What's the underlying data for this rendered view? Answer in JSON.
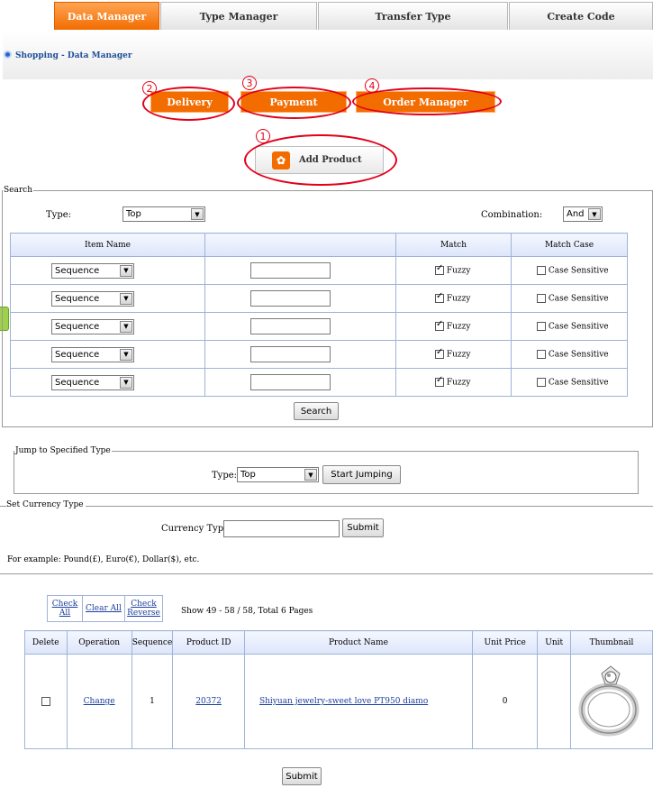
{
  "tabs": [
    {
      "label": "Data Manager",
      "active": true
    },
    {
      "label": "Type Manager"
    },
    {
      "label": "Transfer Type"
    },
    {
      "label": "Create Code"
    }
  ],
  "breadcrumb": "Shopping - Data Manager",
  "actions": {
    "delivery": "Delivery",
    "payment": "Payment",
    "order_manager": "Order Manager",
    "add_product": "Add Product",
    "markers": [
      "1",
      "2",
      "3",
      "4"
    ]
  },
  "search": {
    "legend": "Search",
    "type_label": "Type:",
    "type_value": "Top",
    "combination_label": "Combination:",
    "combination_value": "And",
    "headers": [
      "Item Name",
      "",
      "Match",
      "Match Case"
    ],
    "rows": [
      {
        "item": "Sequence",
        "value": "",
        "fuzzy": "Fuzzy",
        "case": "Case Sensitive"
      },
      {
        "item": "Sequence",
        "value": "",
        "fuzzy": "Fuzzy",
        "case": "Case Sensitive"
      },
      {
        "item": "Sequence",
        "value": "",
        "fuzzy": "Fuzzy",
        "case": "Case Sensitive"
      },
      {
        "item": "Sequence",
        "value": "",
        "fuzzy": "Fuzzy",
        "case": "Case Sensitive"
      },
      {
        "item": "Sequence",
        "value": "",
        "fuzzy": "Fuzzy",
        "case": "Case Sensitive"
      }
    ],
    "button": "Search"
  },
  "jump": {
    "legend": "Jump to Specified Type",
    "type_label": "Type:",
    "type_value": "Top",
    "button": "Start Jumping"
  },
  "currency": {
    "legend": "Set Currency Type",
    "label": "Currency Type:",
    "value": "",
    "button": "Submit",
    "example": "For example: Pound(£), Euro(€), Dollar($), etc."
  },
  "list": {
    "check_all": "Check All",
    "clear_all": "Clear All",
    "check_reverse": "Check Reverse",
    "paging": "Show 49 - 58 / 58, Total 6 Pages",
    "headers": [
      "Delete",
      "Operation",
      "Sequence",
      "Product ID",
      "Product Name",
      "Unit Price",
      "Unit",
      "Thumbnail"
    ],
    "rows": [
      {
        "operation": "Change",
        "sequence": "1",
        "product_id": "20372",
        "product_name": "Shiyuan jewelry-sweet love PT950 diamo",
        "unit_price": "0",
        "unit": ""
      }
    ],
    "submit": "Submit"
  },
  "colors": {
    "accent": "#f26c00",
    "ring": "#e2001a",
    "link": "#1a3f9e"
  }
}
